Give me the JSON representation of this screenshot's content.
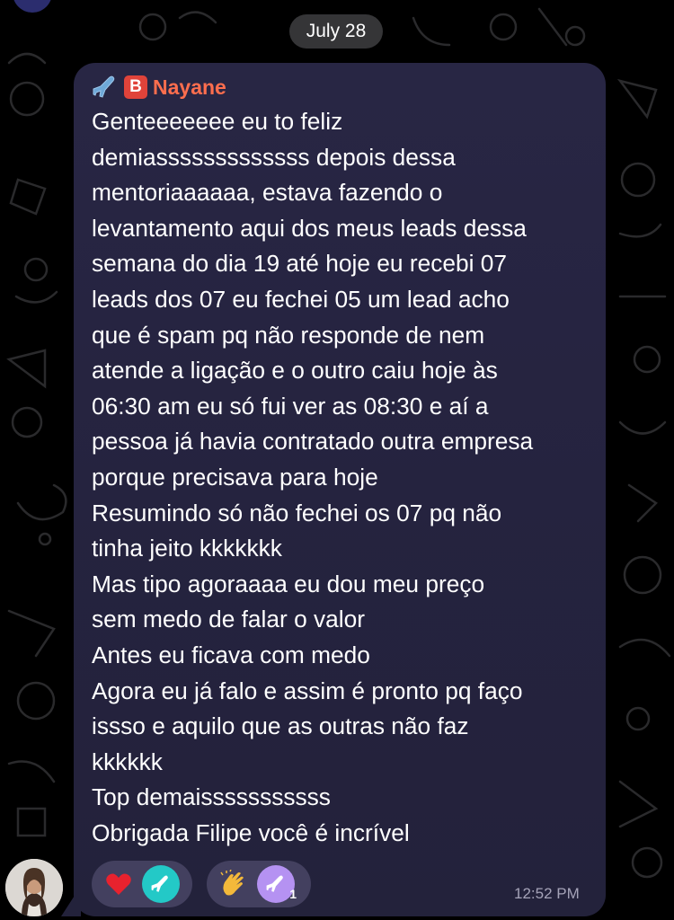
{
  "chat": {
    "date_label": "July 28",
    "message": {
      "sender_name": "Nayane",
      "sender_badge_letter": "B",
      "sender_prefix_icons": [
        "airplane-icon",
        "b-button-icon"
      ],
      "body": "Genteeeeeee eu to feliz\ndemiasssssssssssss depois dessa\nmentoriaaaaaa, estava fazendo o\nlevantamento aqui dos meus leads dessa\nsemana do dia 19 até hoje eu recebi 07\nleads dos 07 eu fechei 05 um lead acho\nque é spam pq não responde de nem\natende a ligação e o outro caiu hoje às\n06:30 am eu só fui ver as 08:30 e aí a\npessoa já havia contratado outra empresa\nporque precisava para hoje\nResumindo só não fechei os 07 pq não\ntinha jeito kkkkkkk\nMas tipo agoraaaa eu dou meu preço\nsem medo de falar o valor\nAntes eu ficava com medo\nAgora eu já falo e assim é pronto pq faço\nissso e aquilo que as outras não faz\nkkkkkk\nTop demaisssssssssss\nObrigada Filipe você é incrível",
      "time": "12:52 PM",
      "reactions": [
        {
          "emoji": "heart-icon",
          "reactor": "airplane-avatar",
          "reactor_color": "#23c9c7",
          "count": ""
        },
        {
          "emoji": "clapping-hands-icon",
          "reactor": "airplane-avatar",
          "reactor_color": "#b592f2",
          "count": "1"
        }
      ]
    }
  },
  "colors": {
    "background": "#000000",
    "bubble": "#262442",
    "sender_name": "#ff6e4e",
    "badge": "#e0433a",
    "timestamp": "#a5a3b8"
  }
}
